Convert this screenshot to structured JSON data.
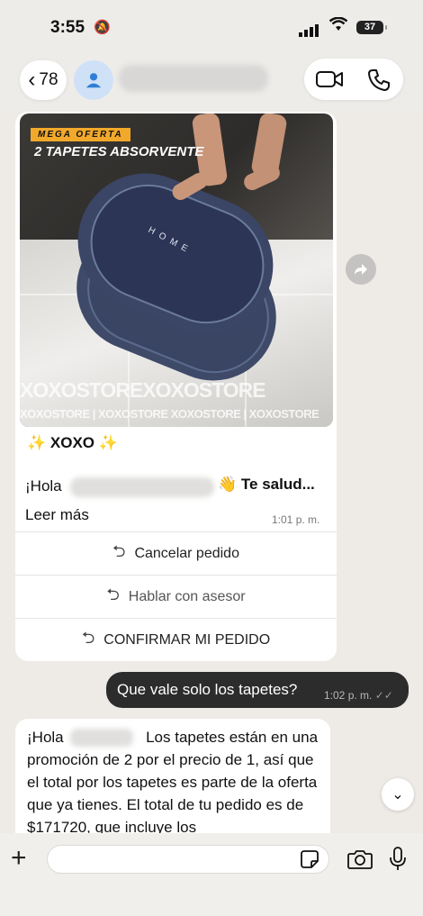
{
  "status_bar": {
    "time": "3:55",
    "battery": "37"
  },
  "header": {
    "back_count": "78"
  },
  "product": {
    "promo_tag": "MEGA OFERTA",
    "promo_title": "2 TAPETES ABSORVENTE",
    "mat_label": "HOME",
    "watermark_large": "XOXOSTOREXOXOSTORE",
    "watermark_small": "XOXOSTORE | XOXOSTORE XOXOSTORE | XOXOSTORE"
  },
  "card": {
    "store_name": "✨ XOXO ✨",
    "greeting_start": "¡Hola",
    "greeting_end": "👋 Te salud...",
    "read_more": "Leer más",
    "time": "1:01 p. m.",
    "actions": [
      {
        "label": "Cancelar pedido"
      },
      {
        "label": "Hablar con asesor"
      },
      {
        "label": "CONFIRMAR MI PEDIDO"
      }
    ]
  },
  "outgoing": {
    "text": "Que vale solo los tapetes?",
    "time": "1:02 p. m."
  },
  "incoming": {
    "text_start": "¡Hola",
    "text_rest": "Los tapetes están en una promoción de 2 por el precio de 1, así que el total por los tapetes es parte de la oferta que ya tienes. El total de tu pedido es de $171720, que incluye los"
  },
  "composer": {
    "placeholder": ""
  }
}
